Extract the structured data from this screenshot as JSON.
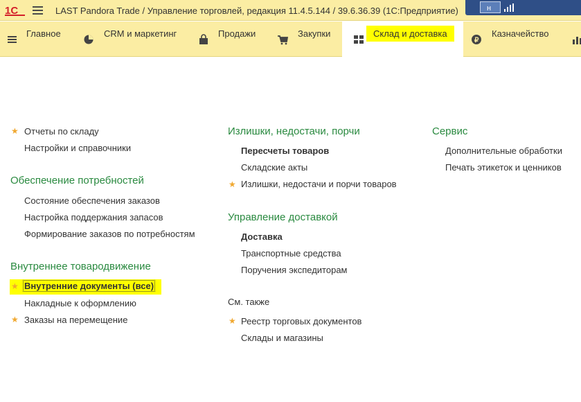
{
  "window": {
    "title": "LAST Pandora Trade / Управление торговлей, редакция 11.4.5.144 / 39.6.36.39  (1С:Предприятие)"
  },
  "colors": {
    "toolbar": "#fbeda3",
    "highlight": "#ffff00",
    "group_title": "#2a8a40",
    "star": "#f0a830"
  },
  "sections": [
    {
      "label": "Главное",
      "icon": "list-icon"
    },
    {
      "label": "CRM и маркетинг",
      "icon": "pie-chart-icon"
    },
    {
      "label": "Продажи",
      "icon": "shopping-bag-icon"
    },
    {
      "label": "Закупки",
      "icon": "cart-icon"
    },
    {
      "label": "Склад и доставка",
      "icon": "warehouse-grid-icon",
      "active": true
    },
    {
      "label": "Казначейство",
      "icon": "ruble-coin-icon"
    },
    {
      "label": "",
      "icon": "bar-chart-icon"
    }
  ],
  "col1": {
    "top_items": [
      {
        "label": "Отчеты по складу",
        "starred": true
      },
      {
        "label": "Настройки и справочники",
        "starred": false
      }
    ],
    "groups": [
      {
        "title": "Обеспечение потребностей",
        "items": [
          {
            "label": "Состояние обеспечения заказов",
            "starred": false
          },
          {
            "label": "Настройка поддержания запасов",
            "starred": false
          },
          {
            "label": "Формирование заказов по потребностям",
            "starred": false
          }
        ]
      },
      {
        "title": "Внутреннее товародвижение",
        "items": [
          {
            "label": "Внутренние документы (все)",
            "starred": true,
            "selected": true
          },
          {
            "label": "Накладные к оформлению",
            "starred": false
          },
          {
            "label": "Заказы на перемещение",
            "starred": true
          }
        ]
      }
    ]
  },
  "col2": {
    "groups": [
      {
        "title": "Излишки, недостачи, порчи",
        "items": [
          {
            "label": "Пересчеты товаров",
            "bold": true
          },
          {
            "label": "Складские акты"
          },
          {
            "label": "Излишки, недостачи и порчи товаров",
            "starred": true
          }
        ]
      },
      {
        "title": "Управление доставкой",
        "items": [
          {
            "label": "Доставка",
            "bold": true
          },
          {
            "label": "Транспортные средства"
          },
          {
            "label": "Поручения экспедиторам"
          }
        ]
      }
    ],
    "see_also": {
      "title": "См. также",
      "items": [
        {
          "label": "Реестр торговых документов",
          "starred": true
        },
        {
          "label": "Склады и магазины"
        }
      ]
    }
  },
  "col3": {
    "groups": [
      {
        "title": "Сервис",
        "items": [
          {
            "label": "Дополнительные обработки"
          },
          {
            "label": "Печать этикеток и ценников"
          }
        ]
      }
    ]
  }
}
